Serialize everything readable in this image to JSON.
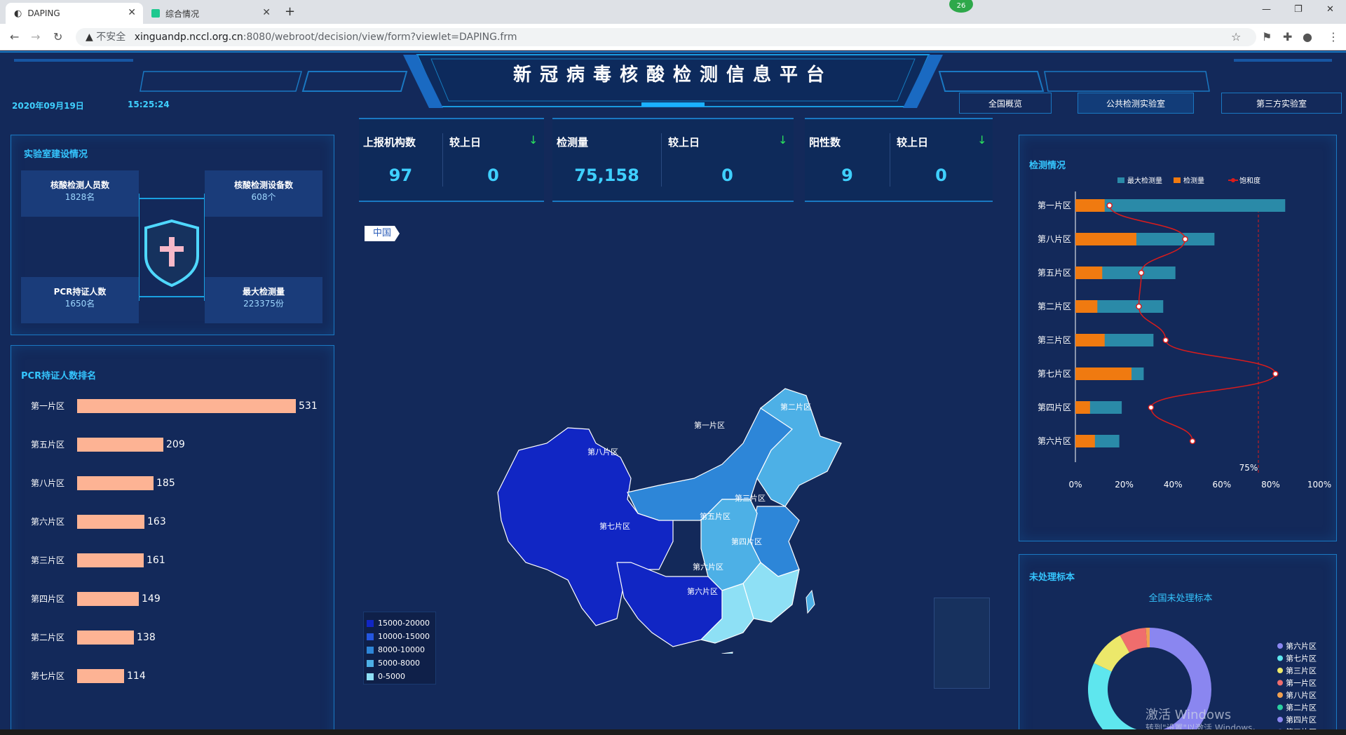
{
  "browser": {
    "tabs": [
      {
        "title": "DAPING",
        "active": true
      },
      {
        "title": "综合情况",
        "active": false
      }
    ],
    "url_insecure": "不安全",
    "url_host": "xinguandp.nccl.org.cn",
    "url_path": ":8080/webroot/decision/view/form?viewlet=DAPING.frm",
    "badge": "26"
  },
  "header": {
    "title": "新冠病毒核酸检测信息平台",
    "date": "2020年09月19日",
    "time": "15:25:24",
    "nav": [
      "全国概览",
      "公共检测实验室",
      "第三方实验室"
    ]
  },
  "lab": {
    "title": "实验室建设情况",
    "items": [
      {
        "label": "核酸检测人员数",
        "value": "1828名"
      },
      {
        "label": "核酸检测设备数",
        "value": "608个"
      },
      {
        "label": "PCR持证人数",
        "value": "1650名"
      },
      {
        "label": "最大检测量",
        "value": "223375份"
      }
    ]
  },
  "pcr": {
    "title": "PCR持证人数排名",
    "rows": [
      {
        "label": "第一片区",
        "value": 531
      },
      {
        "label": "第五片区",
        "value": 209
      },
      {
        "label": "第八片区",
        "value": 185
      },
      {
        "label": "第六片区",
        "value": 163
      },
      {
        "label": "第三片区",
        "value": 161
      },
      {
        "label": "第四片区",
        "value": 149
      },
      {
        "label": "第二片区",
        "value": 138
      },
      {
        "label": "第七片区",
        "value": 114
      }
    ]
  },
  "stats": [
    {
      "label": "上报机构数",
      "value": "97",
      "cmp_label": "较上日",
      "cmp_value": "0",
      "arrow": "↓"
    },
    {
      "label": "检测量",
      "value": "75,158",
      "cmp_label": "较上日",
      "cmp_value": "0",
      "arrow": "↓"
    },
    {
      "label": "阳性数",
      "value": "9",
      "cmp_label": "较上日",
      "cmp_value": "0",
      "arrow": "↓"
    }
  ],
  "map": {
    "tag": "中国",
    "regions": [
      "第一片区",
      "第二片区",
      "第三片区",
      "第四片区",
      "第五片区",
      "第六片区",
      "第七片区",
      "第八片区",
      "第六片区"
    ],
    "legend": [
      {
        "label": "15000-20000",
        "color": "#1126c4"
      },
      {
        "label": "10000-15000",
        "color": "#2456e0"
      },
      {
        "label": "8000-10000",
        "color": "#2d86d8"
      },
      {
        "label": "5000-8000",
        "color": "#4db0e6"
      },
      {
        "label": "0-5000",
        "color": "#8ee0f5"
      }
    ]
  },
  "detect": {
    "title": "检测情况",
    "legend": [
      "最大检测量",
      "检测量",
      "饱和度"
    ]
  },
  "chart_data": [
    {
      "type": "bar",
      "title": "PCR持证人数排名",
      "categories": [
        "第一片区",
        "第五片区",
        "第八片区",
        "第六片区",
        "第三片区",
        "第四片区",
        "第二片区",
        "第七片区"
      ],
      "values": [
        531,
        209,
        185,
        163,
        161,
        149,
        138,
        114
      ]
    },
    {
      "type": "bar",
      "title": "检测情况",
      "orientation": "horizontal",
      "categories": [
        "第一片区",
        "第八片区",
        "第五片区",
        "第二片区",
        "第三片区",
        "第七片区",
        "第四片区",
        "第六片区"
      ],
      "series": [
        {
          "name": "最大检测量",
          "values": [
            86,
            57,
            41,
            36,
            32,
            28,
            19,
            18
          ],
          "color": "#2a8aa8"
        },
        {
          "name": "检测量",
          "values": [
            12,
            25,
            11,
            9,
            12,
            23,
            6,
            8
          ],
          "color": "#f07a10"
        },
        {
          "name": "饱和度",
          "values": [
            14,
            45,
            27,
            26,
            37,
            82,
            31,
            48
          ],
          "color": "#d91c1c"
        }
      ],
      "xlim": [
        0,
        100
      ],
      "xticks": [
        "0%",
        "20%",
        "40%",
        "60%",
        "80%",
        "100%"
      ],
      "markline": {
        "value": 75,
        "label": "75%"
      }
    },
    {
      "type": "pie",
      "title": "未处理标本",
      "subtitle": "全国未处理标本",
      "legend": [
        "第六片区",
        "第七片区",
        "第三片区",
        "第一片区",
        "第八片区",
        "第二片区",
        "第四片区",
        "第五片区"
      ],
      "values": [
        50,
        32,
        10,
        7,
        1
      ],
      "slice_colors": [
        "#8a86f0",
        "#5ee6ee",
        "#ece86a",
        "#f06d6d",
        "#f0a050"
      ]
    }
  ],
  "watermark": {
    "line1": "激活 Windows",
    "line2": "转到\"设置\"以激活 Windows。"
  }
}
